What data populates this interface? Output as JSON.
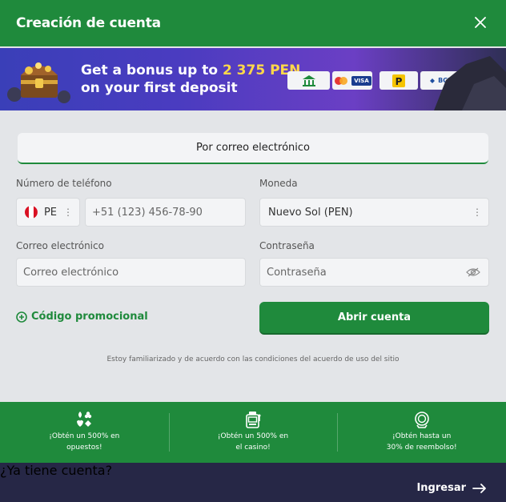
{
  "header": {
    "title": "Creación de cuenta",
    "close_icon": "close-icon"
  },
  "banner": {
    "line1_prefix": "Get a bonus up to ",
    "amount": "2 375 PEN",
    "line2": "on your first deposit",
    "payment_methods": [
      "bank-icon",
      "mastercard-visa-icon",
      "pagoefectivo-icon",
      "bcp-icon"
    ],
    "visa_label": "VISA",
    "bcp_label": "BCP"
  },
  "tab": {
    "label": "Por correo electrónico"
  },
  "form": {
    "phone": {
      "label": "Número de teléfono",
      "country": "PE",
      "placeholder": "+51 (123) 456-78-90"
    },
    "currency": {
      "label": "Moneda",
      "value": "Nuevo Sol (PEN)"
    },
    "email": {
      "label": "Correo electrónico",
      "placeholder": "Correo electrónico"
    },
    "password": {
      "label": "Contraseña",
      "placeholder": "Contraseña"
    },
    "promo_label": "Código promocional",
    "submit_label": "Abrir cuenta",
    "terms": "Estoy familiarizado y de acuerdo con las condiciones del acuerdo de uso del sitio"
  },
  "promos": [
    {
      "icon": "cards-suits-icon",
      "line1": "¡Obtén un 500% en",
      "line2": "opuestos!"
    },
    {
      "icon": "slot-machine-icon",
      "line1": "¡Obtén un 500% en",
      "line2": "el casino!"
    },
    {
      "icon": "cashback-icon",
      "line1": "¡Obtén hasta un",
      "line2": "30% de reembolso!"
    }
  ],
  "footer": {
    "question": "¿Ya tiene cuenta?",
    "login_label": "Ingresar"
  },
  "colors": {
    "green": "#1f8a3c",
    "dark": "#262746",
    "amount": "#ffd84a"
  }
}
